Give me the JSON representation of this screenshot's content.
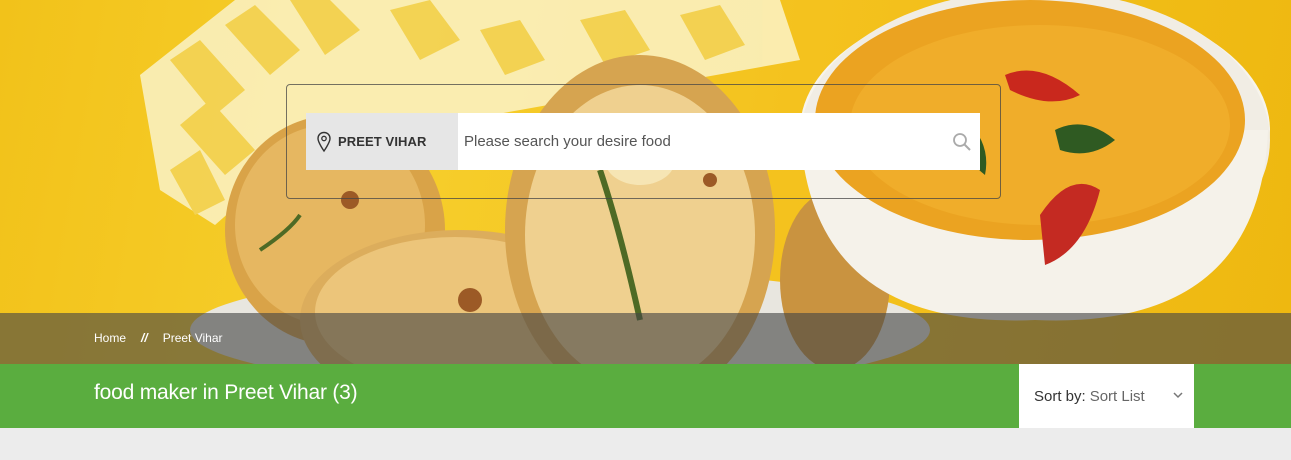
{
  "hero": {
    "image": "food-banner-vada-sambar"
  },
  "search": {
    "location": "PREET VIHAR",
    "placeholder": "Please search your desire food",
    "icon": "search-icon"
  },
  "breadcrumb": {
    "items": [
      "Home",
      "Preet Vihar"
    ],
    "separator": "//"
  },
  "listing": {
    "title": "food maker in Preet Vihar (3)"
  },
  "sort": {
    "label": "Sort by:",
    "value": "Sort List"
  },
  "colors": {
    "accent_green": "#5aad3f",
    "breadcrumb_overlay": "#464646"
  }
}
